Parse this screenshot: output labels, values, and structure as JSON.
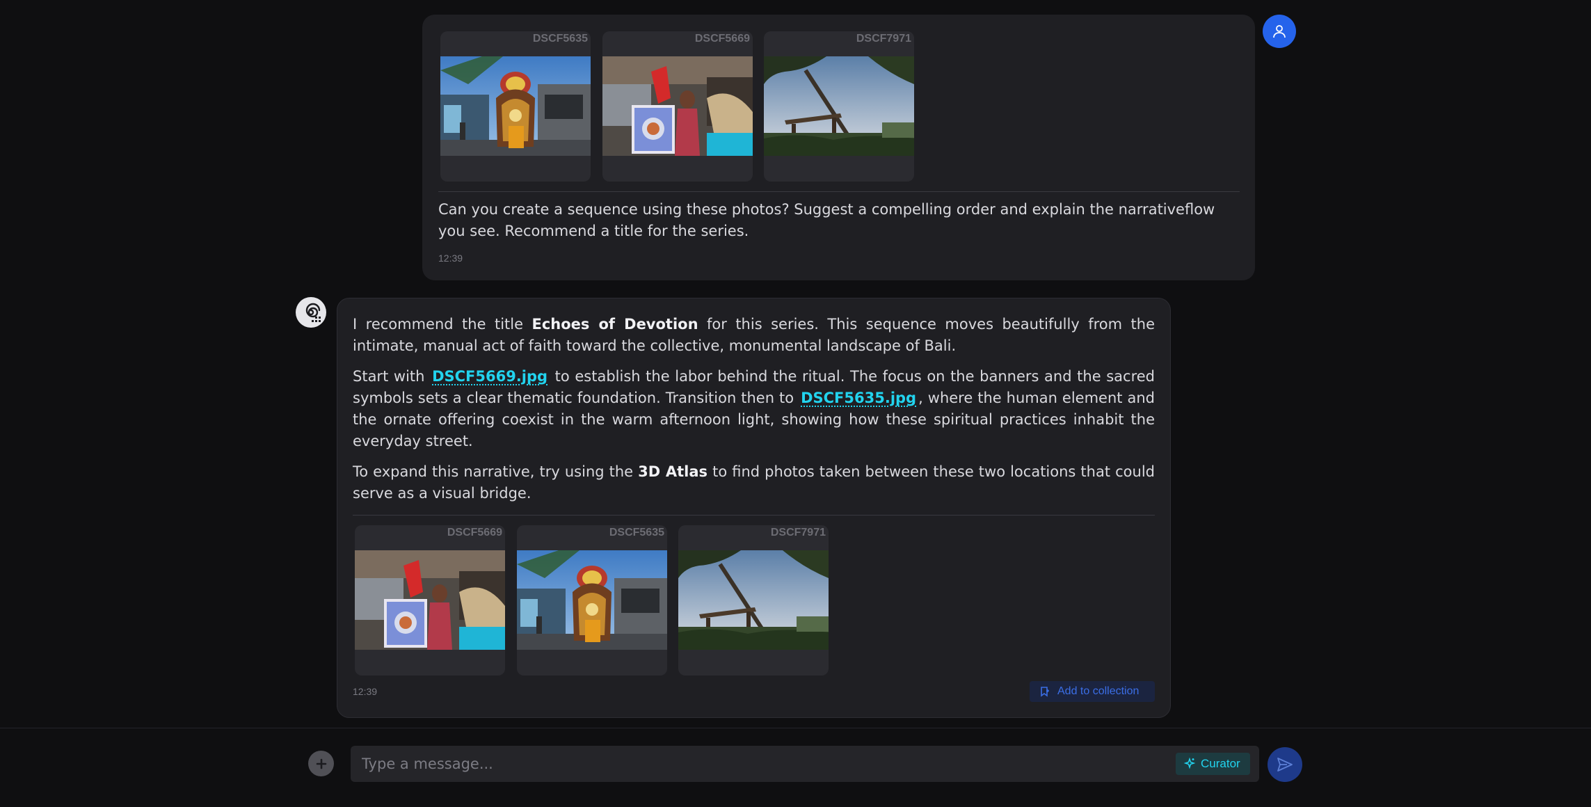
{
  "user_message": {
    "attachments": [
      {
        "name": "DSCF5635",
        "scene": "offering"
      },
      {
        "name": "DSCF5669",
        "scene": "banner"
      },
      {
        "name": "DSCF7971",
        "scene": "coast"
      }
    ],
    "text": "Can you create a sequence using these photos? Suggest a compelling order and explain the narrativeflow you see. Recommend a title for the series.",
    "time": "12:39",
    "avatar_icon": "user-icon"
  },
  "assistant_message": {
    "avatar_icon": "spiral-logo-icon",
    "p1": {
      "a": "I recommend the title ",
      "title": "Echoes of Devotion",
      "b": " for this series. This sequence moves beautifully from the intimate, manual act of faith toward the collective, monumental landscape of Bali."
    },
    "p2": {
      "a": "Start with ",
      "link1": "DSCF5669.jpg",
      "b": " to establish the labor behind the ritual. The focus on the banners and the sacred symbols sets a clear thematic foundation. Transition then to ",
      "link2": "DSCF5635.jpg",
      "c": ", where the human element and the ornate offering coexist in the warm afternoon light, showing how these spiritual practices inhabit the everyday street."
    },
    "p3": {
      "a": "To expand this narrative, try using the ",
      "tool": "3D Atlas",
      "b": " to find photos taken between these two locations that could serve as a visual bridge."
    },
    "attachments": [
      {
        "name": "DSCF5669",
        "scene": "banner"
      },
      {
        "name": "DSCF5635",
        "scene": "offering"
      },
      {
        "name": "DSCF7971",
        "scene": "coast"
      }
    ],
    "time": "12:39",
    "add_to_collection": "Add to collection"
  },
  "composer": {
    "placeholder": "Type a message...",
    "curator_label": "Curator",
    "attach_icon": "plus-icon",
    "send_icon": "send-icon"
  },
  "colors": {
    "accent_blue": "#2563eb",
    "link_cyan": "#22d3ee",
    "bubble_bg": "#1f1f23",
    "page_bg": "#0f0f11"
  }
}
